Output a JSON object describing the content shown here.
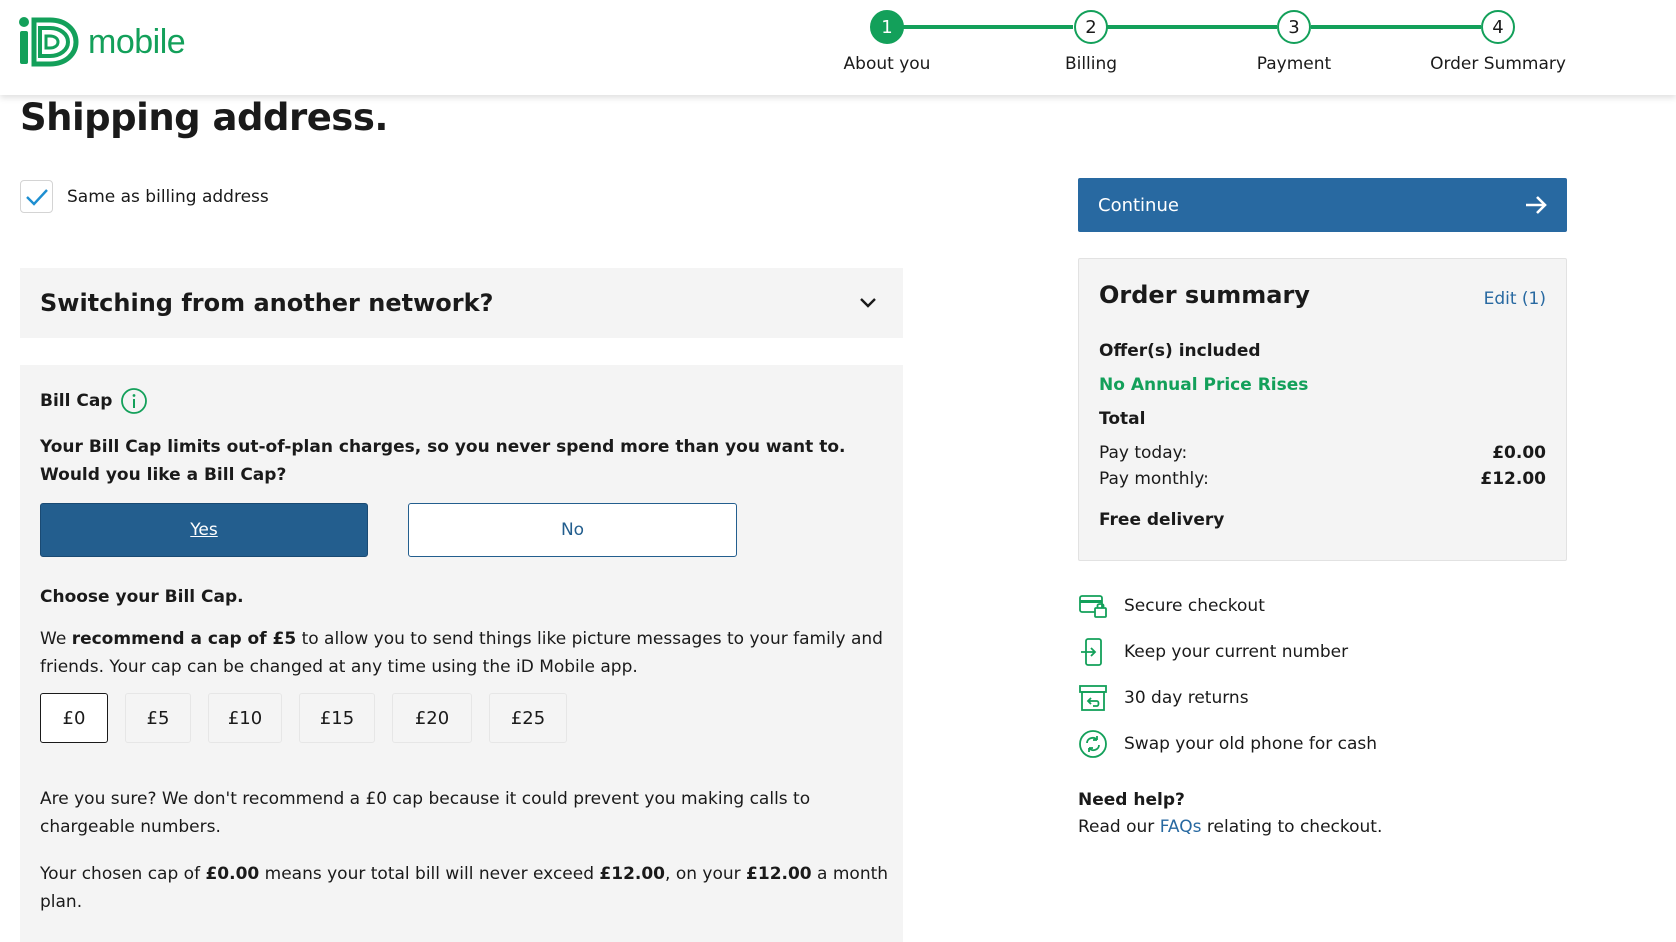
{
  "brand": {
    "name": "mobile",
    "accent": "#13a05a",
    "primary": "#235e8e"
  },
  "stepper": [
    {
      "number": "1",
      "label": "About you",
      "active": true
    },
    {
      "number": "2",
      "label": "Billing",
      "active": false
    },
    {
      "number": "3",
      "label": "Payment",
      "active": false
    },
    {
      "number": "4",
      "label": "Order Summary",
      "active": false
    }
  ],
  "page": {
    "title": "Shipping address.",
    "same_as_billing_label": "Same as billing address",
    "same_as_billing_checked": true
  },
  "switching": {
    "title": "Switching from another network?",
    "icon": "chevron-down-icon"
  },
  "bill_cap": {
    "title": "Bill Cap",
    "question": "Your Bill Cap limits out-of-plan charges, so you never spend more than you want to. Would you like a Bill Cap?",
    "yes_label": "Yes",
    "no_label": "No",
    "choose_title": "Choose your Bill Cap.",
    "recommend_prefix": "We ",
    "recommend_bold": "recommend a cap of £5",
    "recommend_suffix": " to allow you to send things like picture messages to your family and friends. Your cap can be changed at any time using the iD Mobile app.",
    "options": [
      "£0",
      "£5",
      "£10",
      "£15",
      "£20",
      "£25"
    ],
    "selected": "£0",
    "warning": "Are you sure? We don't recommend a £0 cap because it could prevent you making calls to chargeable numbers.",
    "chosen_1": "Your chosen cap of ",
    "chosen_cap": "£0.00",
    "chosen_2": " means your total bill will never exceed ",
    "chosen_total": "£12.00",
    "chosen_3": ", on your ",
    "chosen_plan": "£12.00",
    "chosen_4": " a month plan."
  },
  "sidebar": {
    "continue_label": "Continue",
    "summary": {
      "title": "Order summary",
      "edit_label": "Edit (1)",
      "offers_label": "Offer(s) included",
      "offer": "No Annual Price Rises",
      "total_label": "Total",
      "pay_today_label": "Pay today:",
      "pay_today_value": "£0.00",
      "pay_monthly_label": "Pay monthly:",
      "pay_monthly_value": "£12.00",
      "delivery": "Free delivery"
    },
    "features": [
      {
        "label": "Secure checkout",
        "icon": "secure-card-icon"
      },
      {
        "label": "Keep your current number",
        "icon": "phone-transfer-icon"
      },
      {
        "label": "30 day returns",
        "icon": "return-box-icon"
      },
      {
        "label": "Swap your old phone for cash",
        "icon": "swap-cycle-icon"
      }
    ],
    "help_title": "Need help?",
    "help_prefix": "Read our ",
    "help_link": "FAQs",
    "help_suffix": " relating to checkout."
  }
}
